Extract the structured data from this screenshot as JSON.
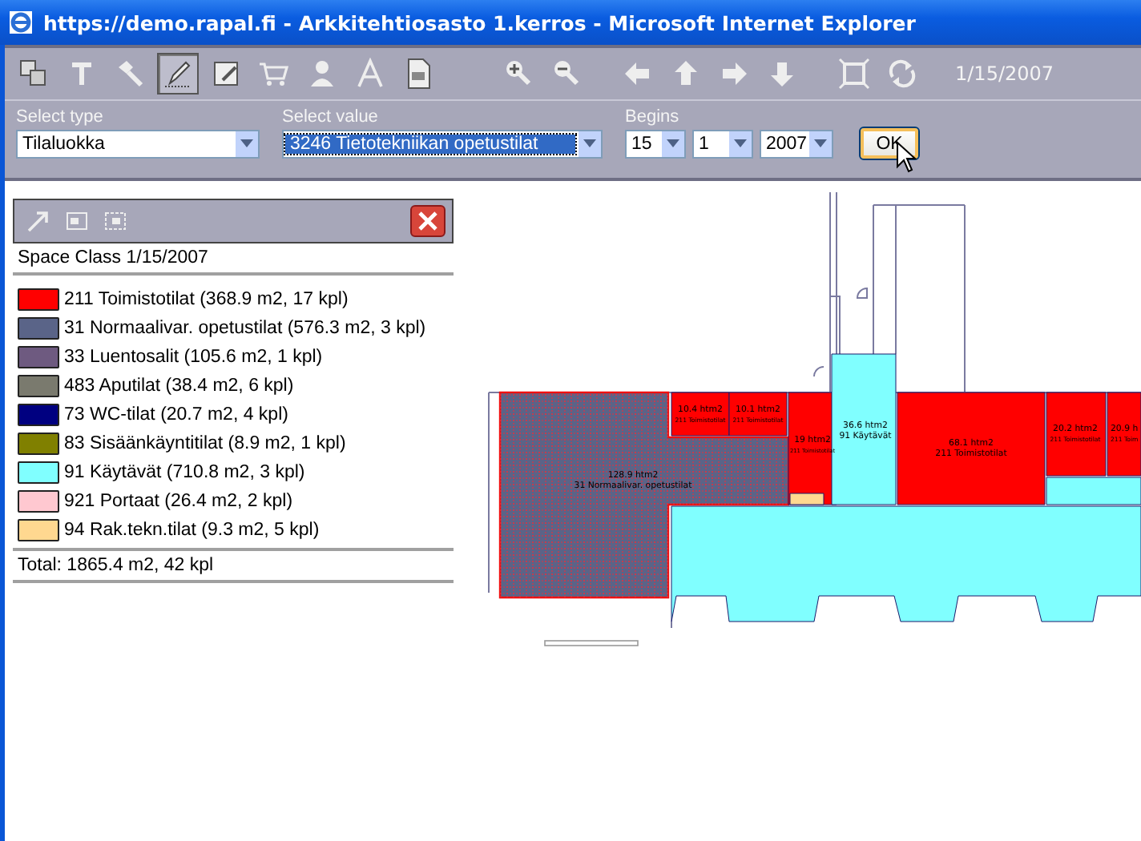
{
  "window": {
    "title": "https://demo.rapal.fi - Arkkitehtiosasto 1.kerros - Microsoft Internet Explorer"
  },
  "toolbar": {
    "groups": [
      [
        {
          "kind": "layers",
          "selected": false
        },
        {
          "kind": "text",
          "selected": false
        },
        {
          "kind": "hammer",
          "selected": false
        },
        {
          "kind": "pencil",
          "selected": true
        },
        {
          "kind": "edit",
          "selected": false
        },
        {
          "kind": "cart",
          "selected": false
        },
        {
          "kind": "person",
          "selected": false
        },
        {
          "kind": "letter",
          "selected": false
        },
        {
          "kind": "pdf",
          "selected": false
        }
      ],
      [
        {
          "kind": "zoomin",
          "selected": false
        },
        {
          "kind": "zoomout",
          "selected": false
        }
      ],
      [
        {
          "kind": "left",
          "selected": false
        },
        {
          "kind": "up",
          "selected": false
        },
        {
          "kind": "right",
          "selected": false
        },
        {
          "kind": "down",
          "selected": false
        }
      ],
      [
        {
          "kind": "fit",
          "selected": false
        },
        {
          "kind": "refresh",
          "selected": false
        }
      ]
    ],
    "date": "1/15/2007"
  },
  "form": {
    "type_label": "Select type",
    "type_value": "Tilaluokka",
    "value_label": "Select value",
    "value_value": "3246 Tietotekniikan opetustilat",
    "begins_label": "Begins",
    "day": "15",
    "month": "1",
    "year": "2007",
    "ok": "OK"
  },
  "panel": {
    "title": "Space Class 1/15/2007",
    "legend": [
      {
        "label": "211 Toimistotilat (368.9 m2, 17 kpl)",
        "color": "#ff0000"
      },
      {
        "label": "31 Normaalivar. opetustilat (576.3 m2, 3 kpl)",
        "color": "#5a6488"
      },
      {
        "label": "33 Luentosalit (105.6 m2, 1 kpl)",
        "color": "#6e5a80"
      },
      {
        "label": "483 Aputilat (38.4 m2, 6 kpl)",
        "color": "#7a7a6e"
      },
      {
        "label": "73 WC-tilat (20.7 m2, 4 kpl)",
        "color": "#000080"
      },
      {
        "label": "83 Sisäänkäyntitilat (8.9 m2, 1 kpl)",
        "color": "#808000"
      },
      {
        "label": "91 Käytävät (710.8 m2, 3 kpl)",
        "color": "#80ffff"
      },
      {
        "label": "921 Portaat (26.4 m2, 2 kpl)",
        "color": "#ffc8d0"
      },
      {
        "label": "94 Rak.tekn.tilat (9.3 m2, 5 kpl)",
        "color": "#ffd890"
      }
    ],
    "total": "Total: 1865.4 m2, 42 kpl"
  },
  "plan": {
    "rooms": [
      {
        "area": "128.9 htm2",
        "class": "31 Normaalivar. opetustilat",
        "color": "#5a6488"
      },
      {
        "area": "10.4 htm2",
        "class": "211 Toimistotilat",
        "color": "#ff0000"
      },
      {
        "area": "10.1 htm2",
        "class": "211 Toimistotilat",
        "color": "#ff0000"
      },
      {
        "area": "19 htm2",
        "class": "211 Toimistotilat",
        "color": "#ff0000"
      },
      {
        "area": "36.6 htm2",
        "class": "91 Käytävät",
        "color": "#80ffff"
      },
      {
        "area": "68.1 htm2",
        "class": "211 Toimistotilat",
        "color": "#ff0000"
      },
      {
        "area": "20.2 htm2",
        "class": "211 Toimistotilat",
        "color": "#ff0000"
      },
      {
        "area": "20.9 h",
        "class": "211 Toim",
        "color": "#ff0000"
      },
      {
        "color": "#80ffff"
      },
      {
        "color": "#80ffff"
      },
      {
        "color": "#ffd890"
      }
    ]
  }
}
